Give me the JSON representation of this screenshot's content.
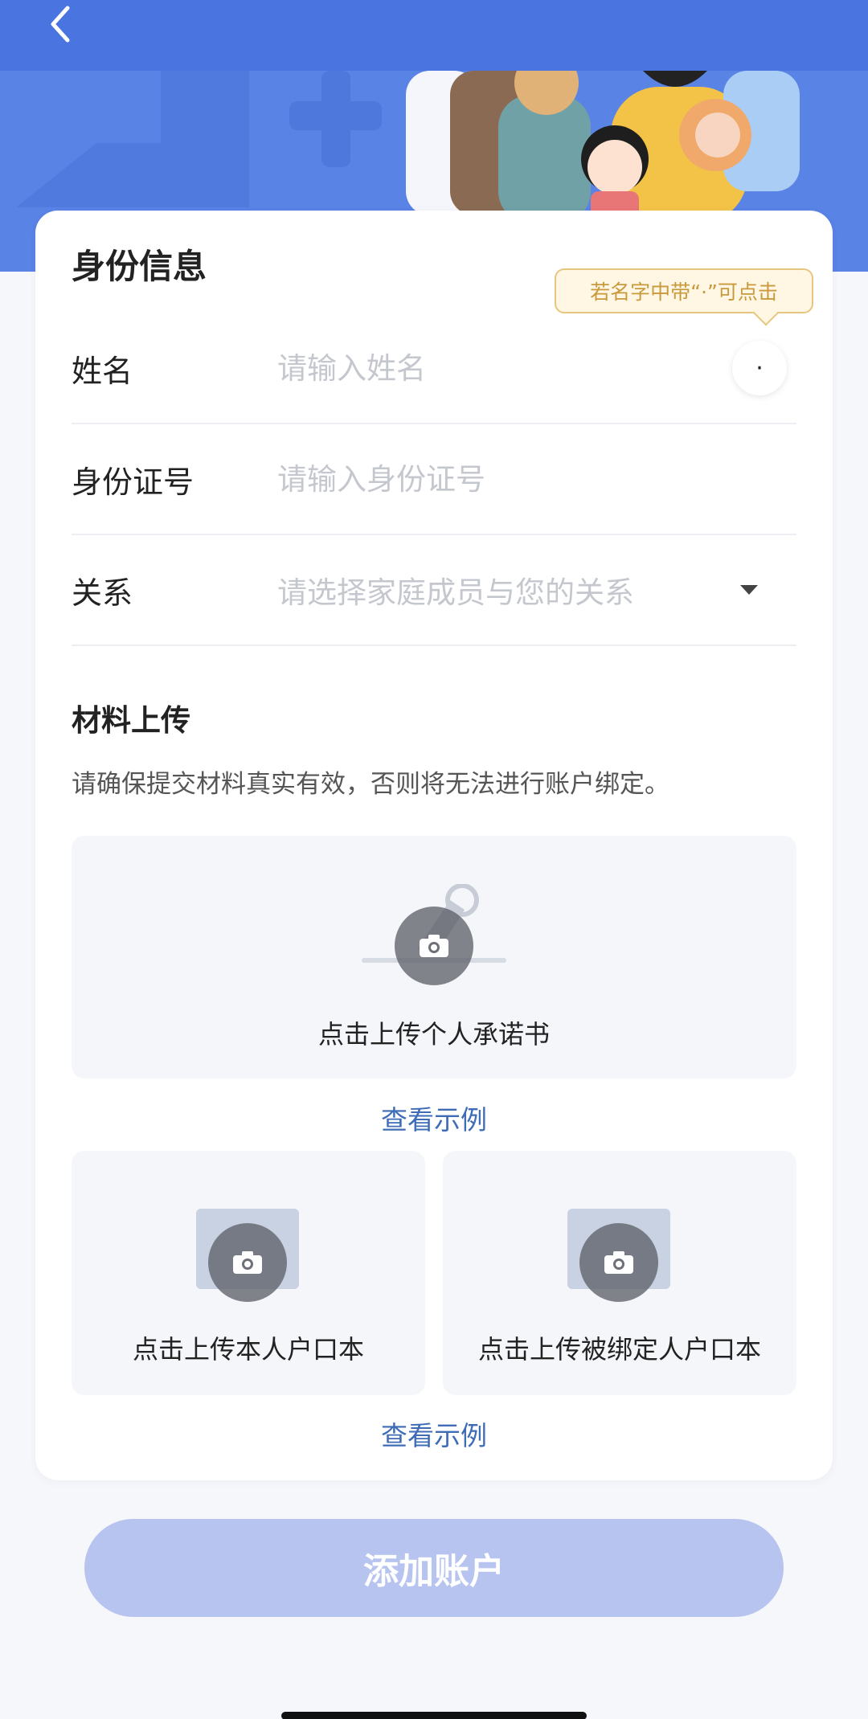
{
  "header": {
    "back_icon": "chevron-left-icon",
    "bg_color": "#4a74df"
  },
  "identity": {
    "title": "身份信息",
    "tip": "若名字中带“·”可点击",
    "dot_symbol": "·",
    "name_label": "姓名",
    "name_placeholder": "请输入姓名",
    "id_label": "身份证号",
    "id_placeholder": "请输入身份证号",
    "relation_label": "关系",
    "relation_placeholder": "请选择家庭成员与您的关系"
  },
  "materials": {
    "title": "材料上传",
    "note": "请确保提交材料真实有效，否则将无法进行账户绑定。",
    "commitment_label": "点击上传个人承诺书",
    "example_link_1": "查看示例",
    "household_self_label": "点击上传本人户口本",
    "household_bound_label": "点击上传被绑定人户口本",
    "example_link_2": "查看示例"
  },
  "submit": {
    "label": "添加账户",
    "color": "#b6c4ef"
  },
  "colors": {
    "accent": "#4a74df",
    "link": "#3e6cb6",
    "tip_border": "#e7c77f",
    "tip_text": "#c99a3c"
  }
}
